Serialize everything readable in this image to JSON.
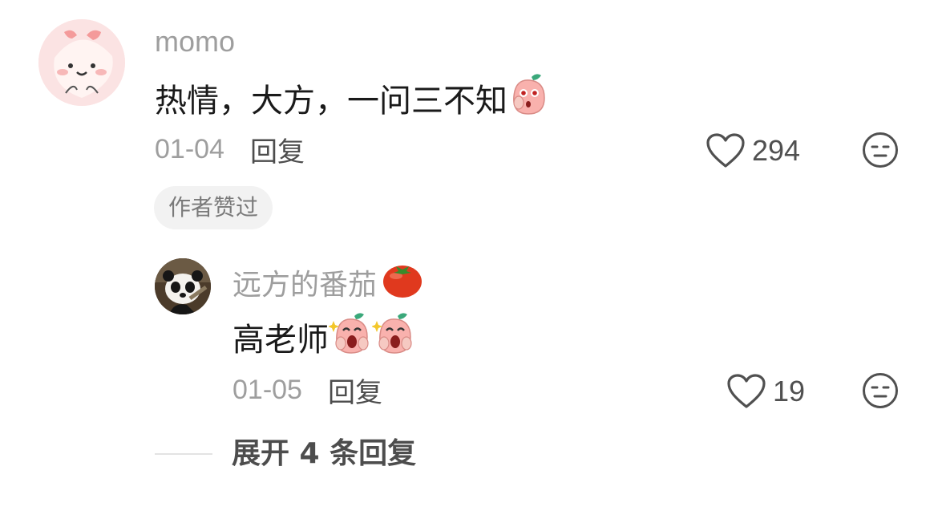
{
  "comment": {
    "username": "momo",
    "text": "热情，大方，一问三不知",
    "emoji_icon": "peach-covering-mouth-emoji",
    "date": "01-04",
    "reply_label": "回复",
    "like_count": "294",
    "author_badge": "作者赞过"
  },
  "reply": {
    "username": "远方的番茄",
    "username_emoji": "tomato-emoji",
    "text": "高老师",
    "emoji_icons": [
      "peach-starstruck-emoji",
      "peach-starstruck-emoji"
    ],
    "date": "01-05",
    "reply_label": "回复",
    "like_count": "19"
  },
  "expand": {
    "label": "展开 4 条回复"
  },
  "colors": {
    "meta_gray": "#9e9e9e",
    "text_dark": "#1a1a1a",
    "badge_bg": "#f2f2f2",
    "peach": "#f7b3b3"
  }
}
